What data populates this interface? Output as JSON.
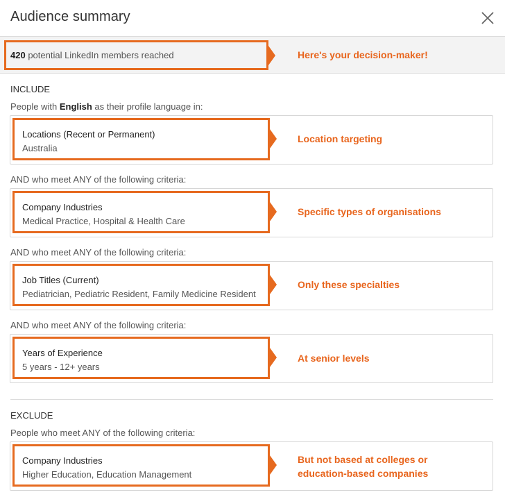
{
  "header": {
    "title": "Audience summary",
    "close_icon": "close-icon"
  },
  "reach": {
    "count": "420",
    "text": " potential LinkedIn members reached"
  },
  "include": {
    "label": "INCLUDE",
    "language_prefix": "People with ",
    "language": "English",
    "language_suffix": " as their profile language in:",
    "criteria_connector": "AND who meet ANY of the following criteria:"
  },
  "cards": [
    {
      "title": "Locations (Recent or Permanent)",
      "value": "Australia"
    },
    {
      "title": "Company Industries",
      "value": "Medical Practice, Hospital & Health Care"
    },
    {
      "title": "Job Titles (Current)",
      "value": "Pediatrician, Pediatric Resident, Family Medicine Resident"
    },
    {
      "title": "Years of Experience",
      "value": "5 years - 12+ years"
    }
  ],
  "exclude": {
    "label": "EXCLUDE",
    "criteria_text": "People who meet ANY of the following criteria:",
    "card": {
      "title": "Company Industries",
      "value": "Higher Education, Education Management"
    }
  },
  "callouts": [
    "Here's your decision-maker!",
    "Location targeting",
    "Specific types of organisations",
    "Only these specialties",
    "At senior levels",
    "But not based at colleges or",
    "education-based companies"
  ],
  "colors": {
    "accent": "#e66a1f",
    "text": "#333333",
    "muted": "#555555"
  }
}
